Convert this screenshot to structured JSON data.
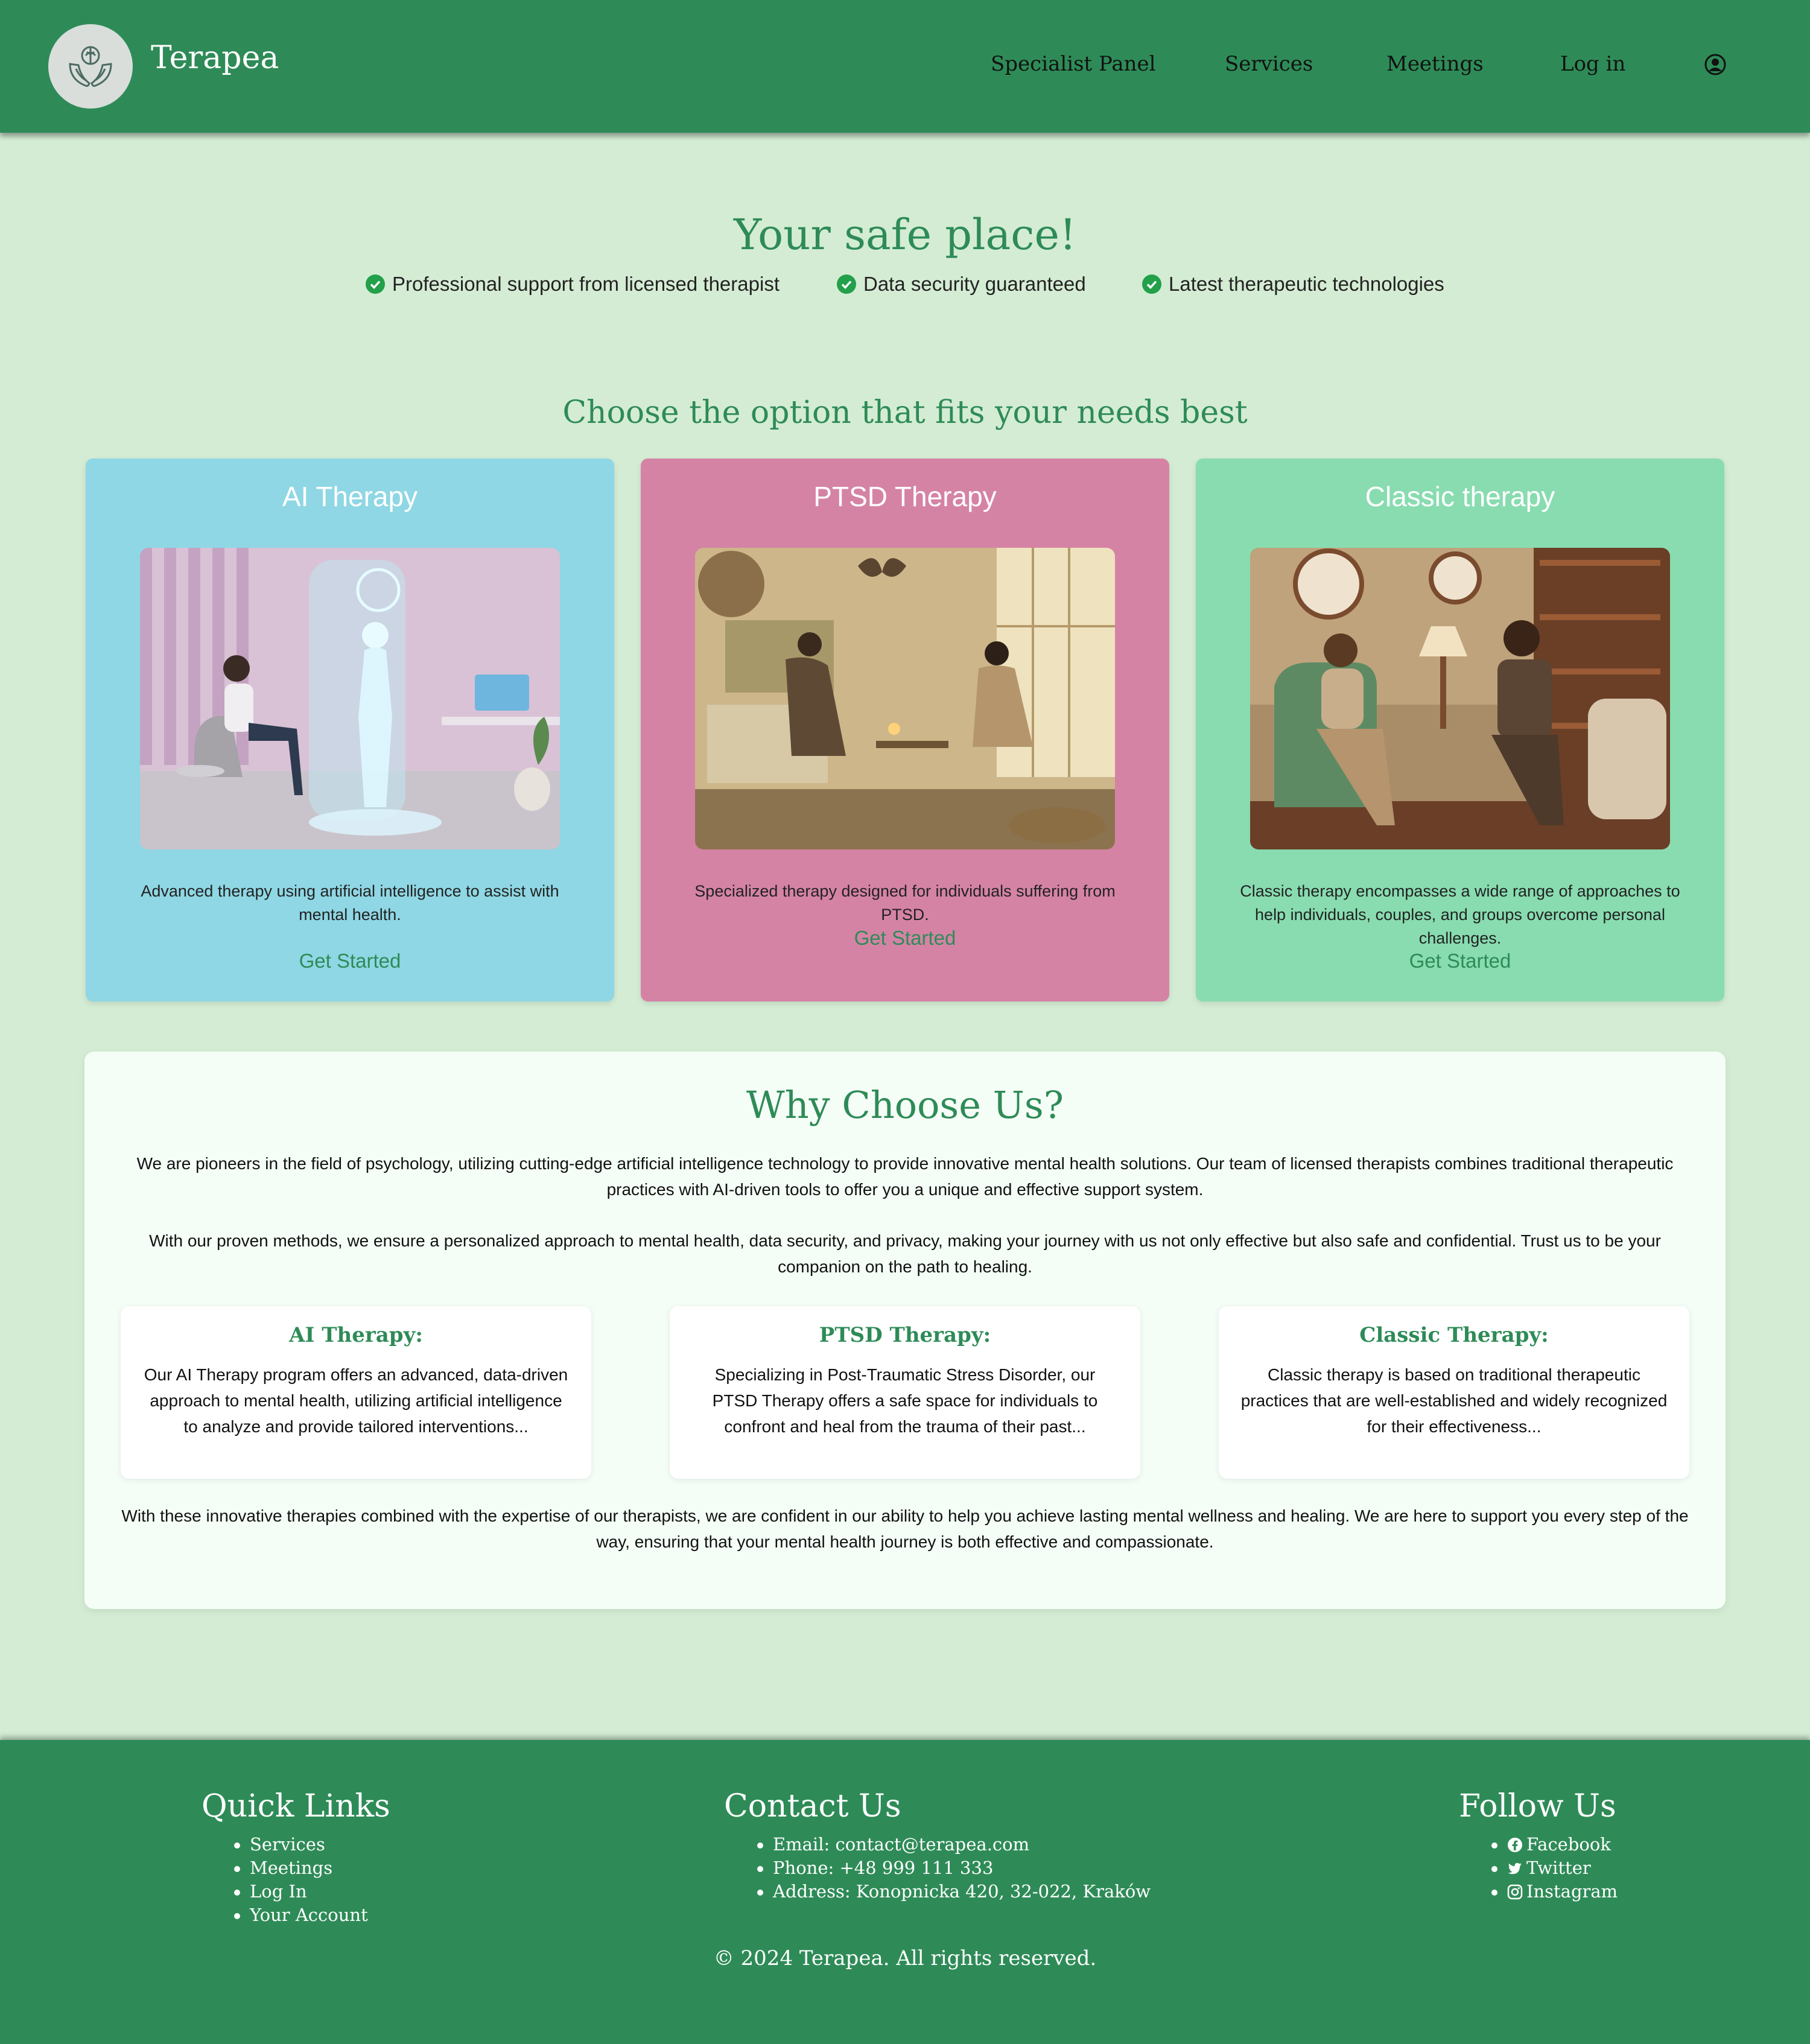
{
  "header": {
    "brand": "Terapea",
    "nav": [
      "Specialist Panel",
      "Services",
      "Meetings",
      "Log in"
    ],
    "user_icon": "user-circle-icon"
  },
  "hero": {
    "title": "Your safe place!",
    "features": [
      "Professional support from licensed therapist",
      "Data security guaranteed",
      "Latest therapeutic technologies"
    ]
  },
  "options": {
    "title": "Choose the option that fits your needs best",
    "cards": [
      {
        "title": "AI Therapy",
        "description": "Advanced therapy using artificial intelligence to assist with mental health.",
        "cta": "Get Started",
        "color": "#8fd7e4"
      },
      {
        "title": "PTSD Therapy",
        "description": "Specialized therapy designed for individuals suffering from PTSD.",
        "cta": "Get Started",
        "color": "#d583a5"
      },
      {
        "title": "Classic therapy",
        "description": "Classic therapy encompasses a wide range of approaches to help individuals, couples, and groups overcome personal challenges.",
        "cta": "Get Started",
        "color": "#88dcb0"
      }
    ]
  },
  "why": {
    "title": "Why Choose Us?",
    "p1": "We are pioneers in the field of psychology, utilizing cutting-edge artificial intelligence technology to provide innovative mental health solutions. Our team of licensed therapists combines traditional therapeutic practices with AI-driven tools to offer you a unique and effective support system.",
    "p2": "With our proven methods, we ensure a personalized approach to mental health, data security, and privacy, making your journey with us not only effective but also safe and confidential. Trust us to be your companion on the path to healing.",
    "items": [
      {
        "title": "AI Therapy:",
        "text": "Our AI Therapy program offers an advanced, data-driven approach to mental health, utilizing artificial intelligence to analyze and provide tailored interventions..."
      },
      {
        "title": "PTSD Therapy:",
        "text": "Specializing in Post-Traumatic Stress Disorder, our PTSD Therapy offers a safe space for individuals to confront and heal from the trauma of their past..."
      },
      {
        "title": "Classic Therapy:",
        "text": "Classic therapy is based on traditional therapeutic practices that are well-established and widely recognized for their effectiveness..."
      }
    ],
    "p3": "With these innovative therapies combined with the expertise of our therapists, we are confident in our ability to help you achieve lasting mental wellness and healing. We are here to support you every step of the way, ensuring that your mental health journey is both effective and compassionate."
  },
  "footer": {
    "quick_links": {
      "title": "Quick Links",
      "items": [
        "Services",
        "Meetings",
        "Log In",
        "Your Account"
      ]
    },
    "contact": {
      "title": "Contact Us",
      "items": [
        "Email: contact@terapea.com",
        "Phone: +48 999 111 333",
        "Address: Konopnicka 420, 32-022, Kraków"
      ]
    },
    "follow": {
      "title": "Follow Us",
      "items": [
        "Facebook",
        "Twitter",
        "Instagram"
      ],
      "icons": [
        "facebook-icon",
        "twitter-icon",
        "instagram-icon"
      ]
    },
    "copyright": "© 2024 Terapea. All rights reserved."
  },
  "colors": {
    "primary": "#2e8b57",
    "background": "#d4ecd4",
    "check": "#22a04a"
  }
}
